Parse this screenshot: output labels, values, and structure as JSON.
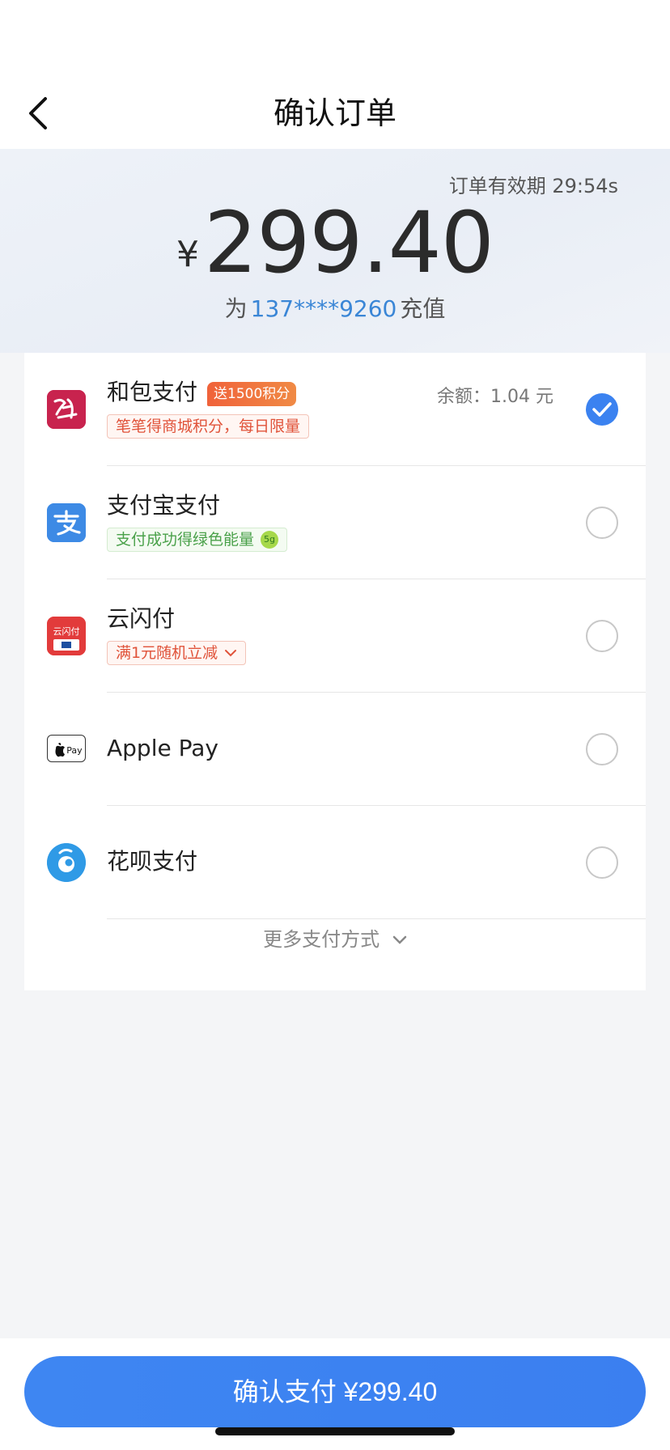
{
  "nav": {
    "title": "确认订单"
  },
  "order": {
    "validity_text": "订单有效期 29:54s",
    "currency": "¥",
    "amount": "299.40",
    "recharge_prefix": "为",
    "phone": "137****9260",
    "recharge_suffix": "充值"
  },
  "payment_methods": [
    {
      "name": "和包支付",
      "badge": "送1500积分",
      "balance": "余额：1.04 元",
      "tag": "笔笔得商城积分，每日限量",
      "selected": true,
      "icon": "hebao-icon"
    },
    {
      "name": "支付宝支付",
      "tag": "支付成功得绿色能量",
      "tag_icon_text": "5g",
      "selected": false,
      "icon": "alipay-icon"
    },
    {
      "name": "云闪付",
      "tag": "满1元随机立减",
      "selected": false,
      "icon": "unionpay-icon",
      "icon_text": "云闪付"
    },
    {
      "name": "Apple Pay",
      "selected": false,
      "icon": "apple-pay-icon",
      "icon_text": "Pay"
    },
    {
      "name": "花呗支付",
      "selected": false,
      "icon": "huabei-icon"
    }
  ],
  "more": {
    "label": "更多支付方式"
  },
  "confirm": {
    "label": "确认支付 ¥299.40"
  },
  "colors": {
    "accent": "#3b82f0",
    "phone": "#3a86d6",
    "promo": "#f0623a"
  }
}
